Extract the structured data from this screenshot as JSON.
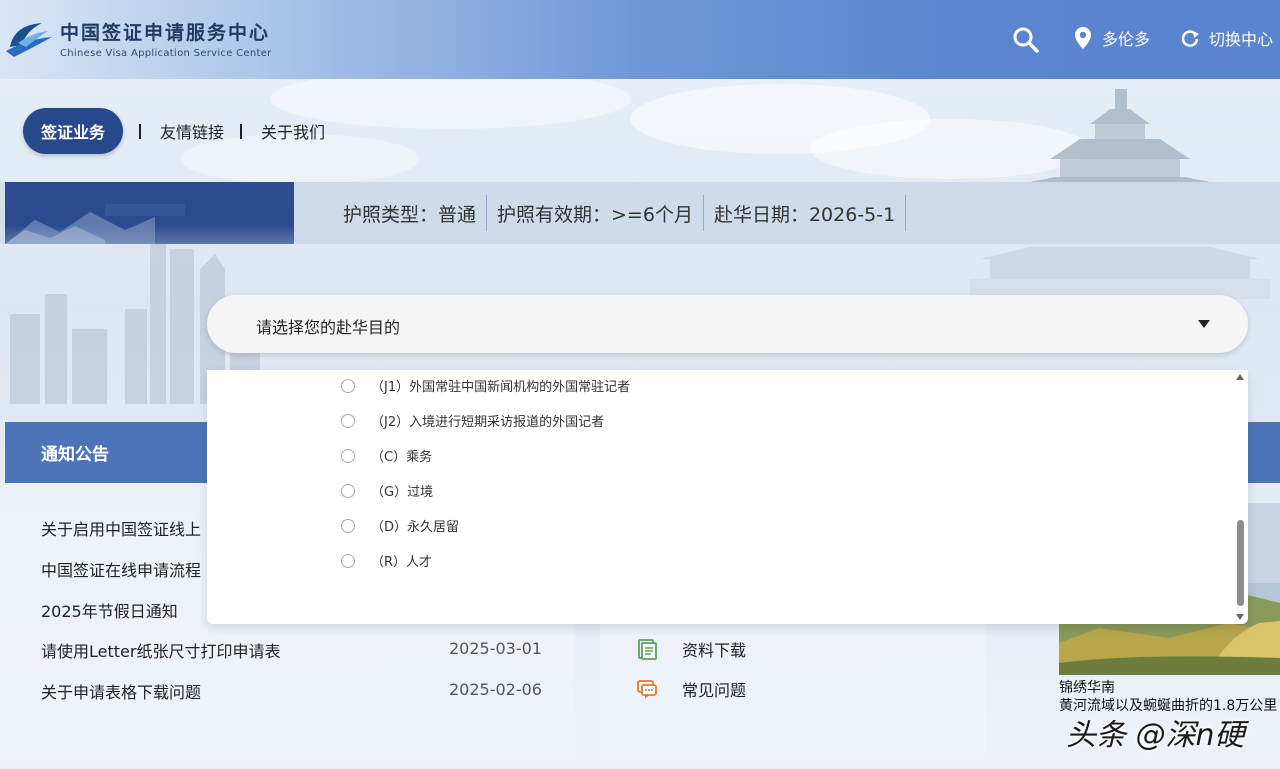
{
  "header": {
    "logo_cn": "中国签证申请服务中心",
    "logo_en": "Chinese Visa Application Service Center",
    "location_label": "多伦多",
    "switch_label": "切换中心",
    "brand_color": "#5a84d0"
  },
  "nav": {
    "items": [
      {
        "label": "签证业务",
        "active": true
      },
      {
        "label": "友情链接",
        "active": false
      },
      {
        "label": "关于我们",
        "active": false
      }
    ]
  },
  "info_bar": {
    "passport_type": "护照类型：普通",
    "passport_validity": "护照有效期：>=6个月",
    "travel_date": "赴华日期：2026-5-1"
  },
  "purpose_select": {
    "placeholder": "请选择您的赴华目的",
    "options": [
      "（J1）外国常驻中国新闻机构的外国常驻记者",
      "（J2）入境进行短期采访报道的外国记者",
      "（C）乘务",
      "（G）过境",
      "（D）永久居留",
      "（R）人才"
    ]
  },
  "notice": {
    "title": "通知公告",
    "items": [
      {
        "title": "关于启用中国签证线上",
        "date": ""
      },
      {
        "title": "中国签证在线申请流程",
        "date": ""
      },
      {
        "title": "2025年节假日通知",
        "date": ""
      },
      {
        "title": "请使用Letter纸张尺寸打印申请表",
        "date": "2025-03-01"
      },
      {
        "title": "关于申请表格下载问题",
        "date": "2025-02-06"
      }
    ]
  },
  "quick_links": [
    {
      "label": "资料下载",
      "icon": "document-icon",
      "color": "#5aa05a"
    },
    {
      "label": "常见问题",
      "icon": "chat-bubble-icon",
      "color": "#e07a2a"
    }
  ],
  "side_card": {
    "title": "锦绣华南",
    "description": "黄河流域以及蜿蜒曲折的1.8万公里"
  },
  "watermark": "头条 @深n硬"
}
